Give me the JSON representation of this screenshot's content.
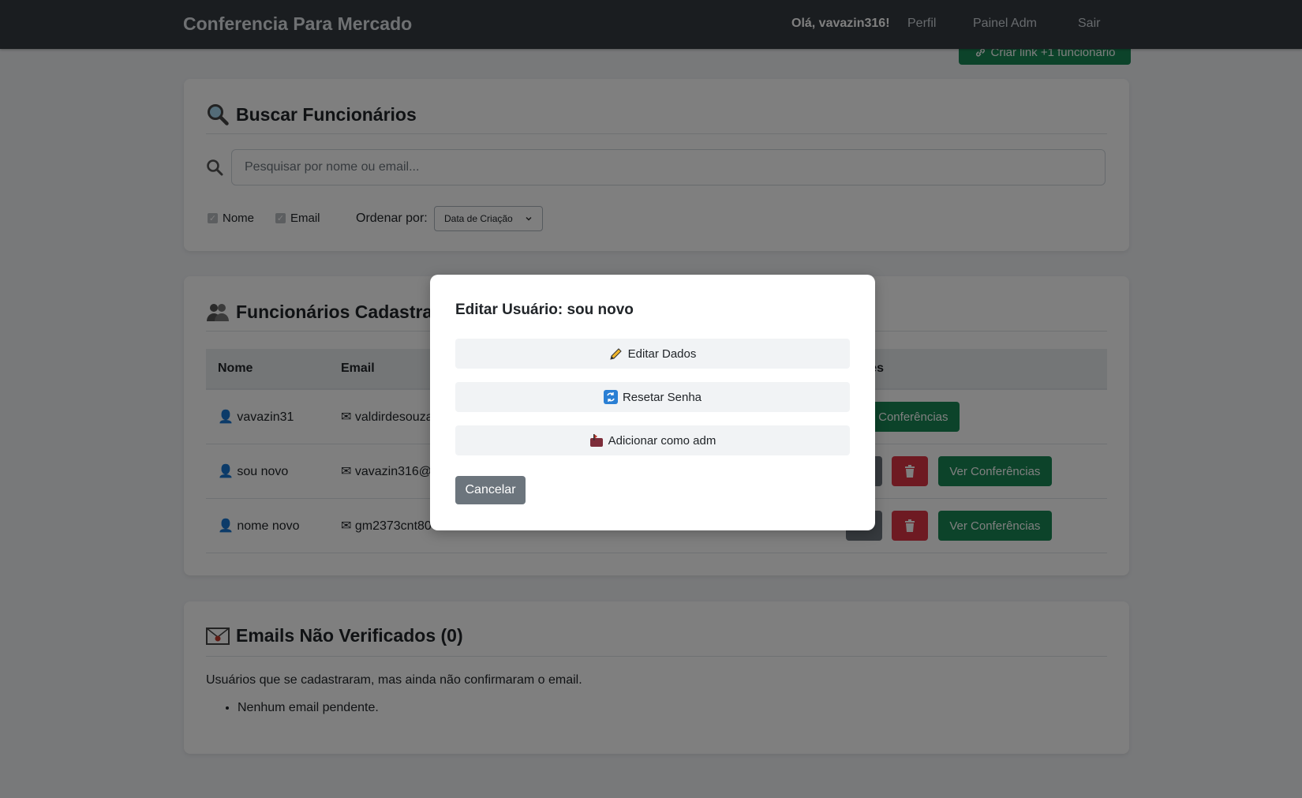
{
  "nav": {
    "brand": "Conferencia Para Mercado",
    "greeting": "Olá, vavazin316!",
    "links": [
      "Perfil",
      "Painel Adm",
      "Sair"
    ]
  },
  "create_link_button": "Criar link +1 funcionario",
  "search_card": {
    "title": "Buscar Funcionários",
    "placeholder": "Pesquisar por nome ou email...",
    "filters": [
      "Nome",
      "Email"
    ],
    "order_label": "Ordenar por:",
    "order_value": "Data de Criação"
  },
  "employees_card": {
    "title": "Funcionários Cadastrados",
    "columns": [
      "Nome",
      "Email",
      "Ações"
    ],
    "rows": [
      {
        "name": "vavazin31",
        "email": "valdirdesouza"
      },
      {
        "name": "sou novo",
        "email": "vavazin316@"
      },
      {
        "name": "nome novo",
        "email": "gm2373cnt80"
      }
    ],
    "view_button": "Ver Conferências"
  },
  "unverified_card": {
    "title": "Emails Não Verificados (0)",
    "description": "Usuários que se cadastraram, mas ainda não confirmaram o email.",
    "empty_item": "Nenhum email pendente."
  },
  "modal": {
    "title": "Editar Usuário: sou novo",
    "edit_label": "Editar Dados",
    "reset_label": "Resetar Senha",
    "admin_label": "Adicionar como adm",
    "cancel_label": "Cancelar"
  },
  "colors": {
    "navbar": "#343a40",
    "primary_green": "#198754",
    "danger_red": "#dc3545",
    "secondary_gray": "#6c757d"
  }
}
